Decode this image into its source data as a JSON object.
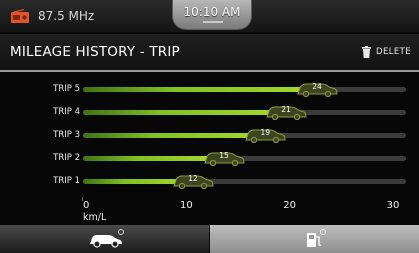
{
  "status": {
    "frequency": "87.5 MHz",
    "time": "10:10 AM"
  },
  "header": {
    "title": "MILEAGE HISTORY - TRIP",
    "delete_label": "DELETE"
  },
  "chart_data": {
    "type": "bar",
    "orientation": "horizontal",
    "categories": [
      "TRIP 5",
      "TRIP 4",
      "TRIP 3",
      "TRIP 2",
      "TRIP 1"
    ],
    "values": [
      24,
      21,
      19,
      15,
      12
    ],
    "xlabel": "km/L",
    "xlim": [
      0,
      30
    ],
    "xticks": [
      "0",
      "10",
      "20",
      "30"
    ],
    "bar_color": "#8cc63f"
  },
  "tabs": [
    {
      "label": "",
      "icon": "car-icon",
      "active": false
    },
    {
      "label": "",
      "icon": "fuel-pump-icon",
      "active": true
    }
  ]
}
